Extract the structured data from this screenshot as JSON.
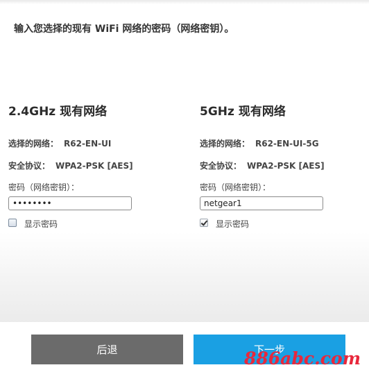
{
  "instruction": "输入您选择的现有 WiFi 网络的密码（网络密钥）。",
  "networks": [
    {
      "title": "2.4GHz 现有网络",
      "network_label": "选择的网络：",
      "network_value": "R62-EN-UI",
      "security_label": "安全协议：",
      "security_value": "WPA2-PSK [AES]",
      "password_label": "密码（网络密钥）：",
      "password_value": "••••••••",
      "show_password_label": "显示密码",
      "show_password_checked": false
    },
    {
      "title": "5GHz 现有网络",
      "network_label": "选择的网络：",
      "network_value": "R62-EN-UI-5G",
      "security_label": "安全协议：",
      "security_value": "WPA2-PSK [AES]",
      "password_label": "密码（网络密钥）：",
      "password_value": "netgear1",
      "show_password_label": "显示密码",
      "show_password_checked": true
    }
  ],
  "buttons": {
    "back_label": "后退",
    "next_label": "下一步"
  },
  "watermark": "886abc.com",
  "colors": {
    "back_button": "#6b6b6b",
    "next_button": "#1aa0e3",
    "watermark": "#e8283c"
  }
}
